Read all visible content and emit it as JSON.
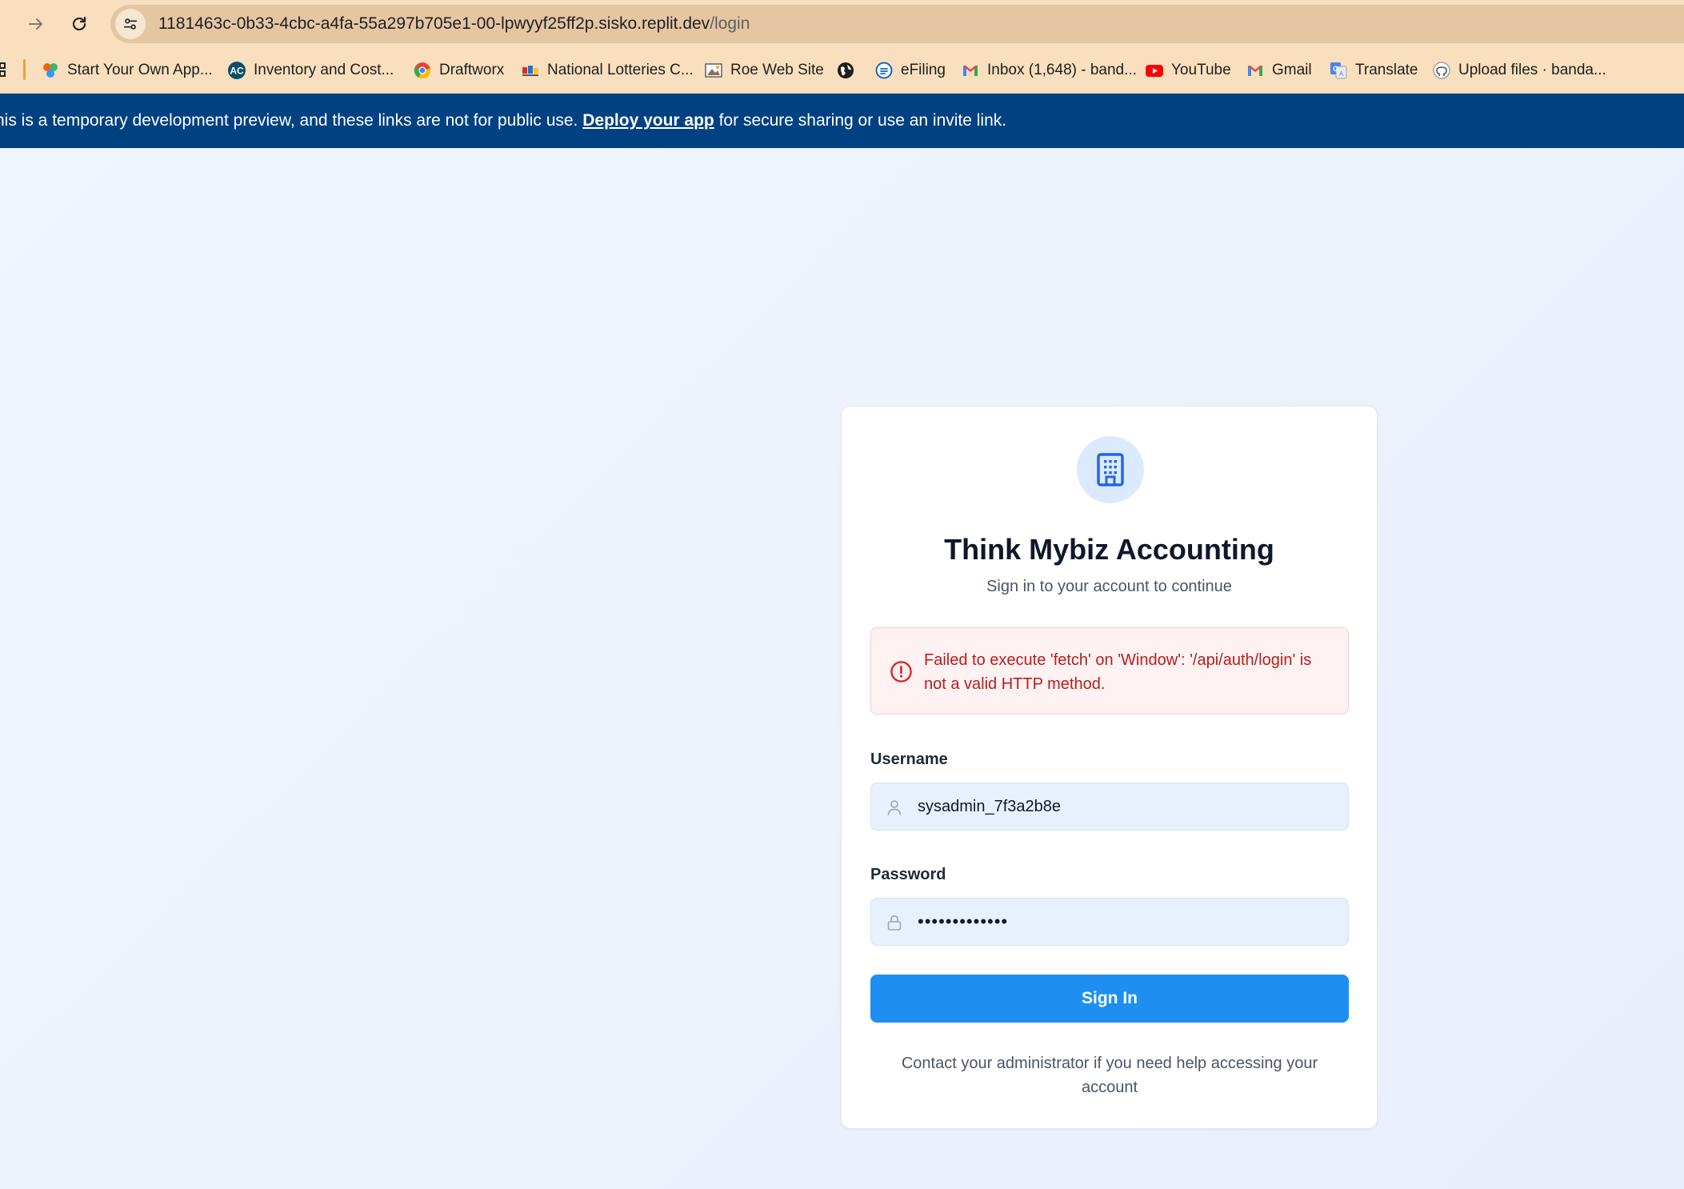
{
  "browser": {
    "url_host": "1181463c-0b33-4cbc-a4fa-55a297b705e1-00-lpwyyf25ff2p.sisko.replit.dev",
    "url_path": "/login",
    "bookmarks": [
      {
        "label": "Start Your Own App...",
        "icon": "replit-icon"
      },
      {
        "label": "Inventory and Cost...",
        "icon": "ac-icon"
      },
      {
        "label": "Draftworx",
        "icon": "chrome-icon"
      },
      {
        "label": "National Lotteries C...",
        "icon": "nlc-icon"
      },
      {
        "label": "Roe Web Site",
        "icon": "image-icon"
      },
      {
        "label": "",
        "icon": "globe-icon"
      },
      {
        "label": "eFiling",
        "icon": "efiling-icon"
      },
      {
        "label": "Inbox (1,648) - band...",
        "icon": "gmail-icon"
      },
      {
        "label": "YouTube",
        "icon": "youtube-icon"
      },
      {
        "label": "Gmail",
        "icon": "gmail-icon"
      },
      {
        "label": "Translate",
        "icon": "translate-icon"
      },
      {
        "label": "Upload files · banda...",
        "icon": "github-icon"
      }
    ]
  },
  "banner": {
    "text_before": "his is a temporary development preview, and these links are not for public use. ",
    "link": "Deploy your app",
    "text_after": " for secure sharing or use an invite link."
  },
  "login": {
    "title": "Think Mybiz Accounting",
    "subtitle": "Sign in to your account to continue",
    "error": "Failed to execute 'fetch' on 'Window': '/api/auth/login' is not a valid HTTP method.",
    "username_label": "Username",
    "username_value": "sysadmin_7f3a2b8e",
    "password_label": "Password",
    "password_value": "•••••••••••••",
    "submit_label": "Sign In",
    "help_text": "Contact your administrator if you need help accessing your account"
  },
  "colors": {
    "chrome": "#f9dfbd",
    "banner": "#004182",
    "primary": "#1e8ff0",
    "error_text": "#b91c1c",
    "error_bg": "#fef2f2"
  }
}
